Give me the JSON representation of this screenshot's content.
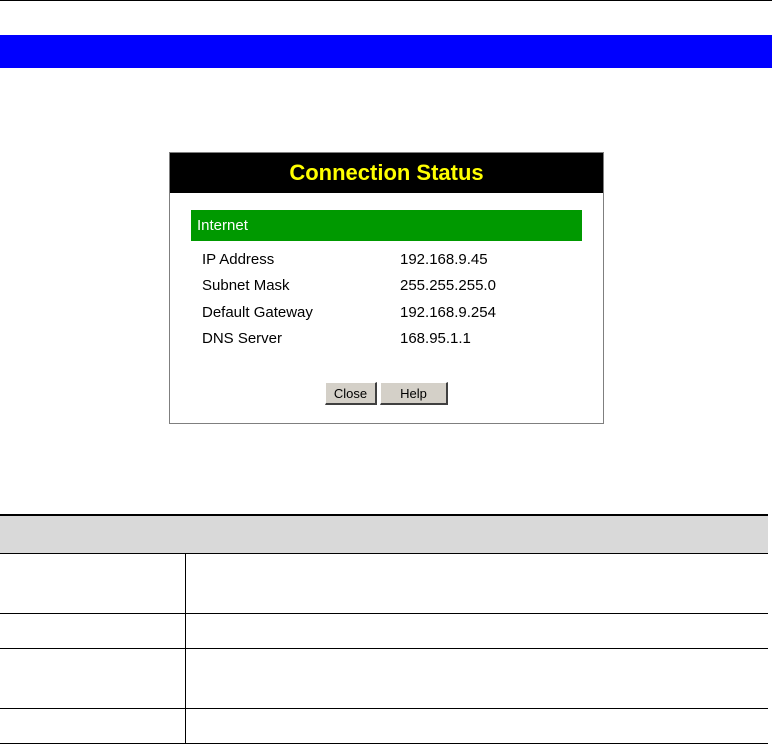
{
  "dialog": {
    "title": "Connection Status",
    "section": "Internet",
    "rows": [
      {
        "label": "IP Address",
        "value": "192.168.9.45"
      },
      {
        "label": "Subnet Mask",
        "value": "255.255.255.0"
      },
      {
        "label": "Default Gateway",
        "value": "192.168.9.254"
      },
      {
        "label": "DNS Server",
        "value": "168.95.1.1"
      }
    ],
    "buttons": {
      "close": "Close",
      "help": "Help"
    }
  },
  "colors": {
    "header_bar": "#0000ff",
    "dialog_title_bg": "#000000",
    "dialog_title_text": "#ffff00",
    "section_bg": "#009900",
    "table_header_bg": "#d9d9d9"
  }
}
